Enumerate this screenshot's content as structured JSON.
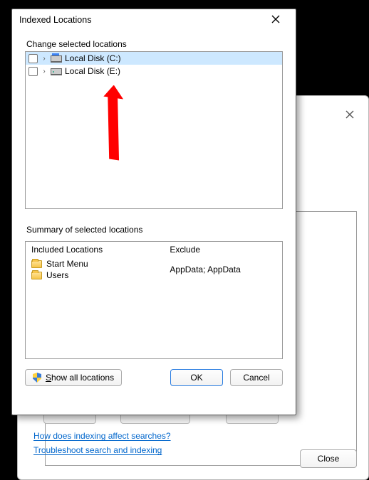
{
  "dialog": {
    "title": "Indexed Locations",
    "changeLabel": "Change selected locations",
    "tree": [
      {
        "label": "Local Disk (C:)",
        "selected": true,
        "iconClass": "c"
      },
      {
        "label": "Local Disk (E:)",
        "selected": false,
        "iconClass": "e"
      }
    ],
    "summaryLabel": "Summary of selected locations",
    "includedHeader": "Included Locations",
    "excludeHeader": "Exclude",
    "included": [
      "Start Menu",
      "Users"
    ],
    "excludeText": "AppData; AppData",
    "showAll": "Show all locations",
    "ok": "OK",
    "cancel": "Cancel"
  },
  "backWindow": {
    "closeBtn": "Close",
    "link1": "How does indexing affect searches?",
    "link2": "Troubleshoot search and indexing"
  }
}
